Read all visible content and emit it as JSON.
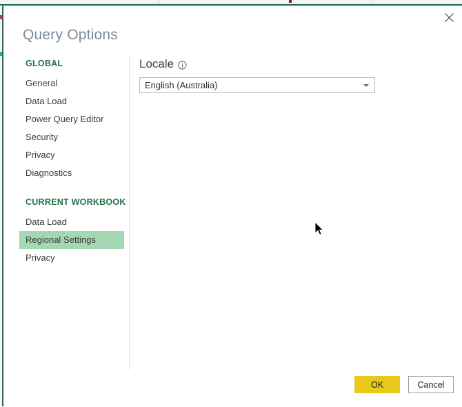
{
  "dialog": {
    "title": "Query Options",
    "close_icon": "close-icon"
  },
  "sidebar": {
    "groups": [
      {
        "header": "GLOBAL",
        "items": [
          {
            "label": "General",
            "selected": false
          },
          {
            "label": "Data Load",
            "selected": false
          },
          {
            "label": "Power Query Editor",
            "selected": false
          },
          {
            "label": "Security",
            "selected": false
          },
          {
            "label": "Privacy",
            "selected": false
          },
          {
            "label": "Diagnostics",
            "selected": false
          }
        ]
      },
      {
        "header": "CURRENT WORKBOOK",
        "items": [
          {
            "label": "Data Load",
            "selected": false
          },
          {
            "label": "Regional Settings",
            "selected": true
          },
          {
            "label": "Privacy",
            "selected": false
          }
        ]
      }
    ]
  },
  "content": {
    "section_label": "Locale",
    "info_icon": "info-circle-icon",
    "locale_select": {
      "value": "English (Australia)",
      "arrow_icon": "chevron-down-icon"
    }
  },
  "footer": {
    "ok_label": "OK",
    "cancel_label": "Cancel"
  },
  "colors": {
    "accent_green": "#1f7147",
    "selection_green": "#a4d8b3",
    "ok_gold": "#e7c81b",
    "title_gray": "#7d8a9a",
    "backdrop_rule": "#1f6f47"
  }
}
